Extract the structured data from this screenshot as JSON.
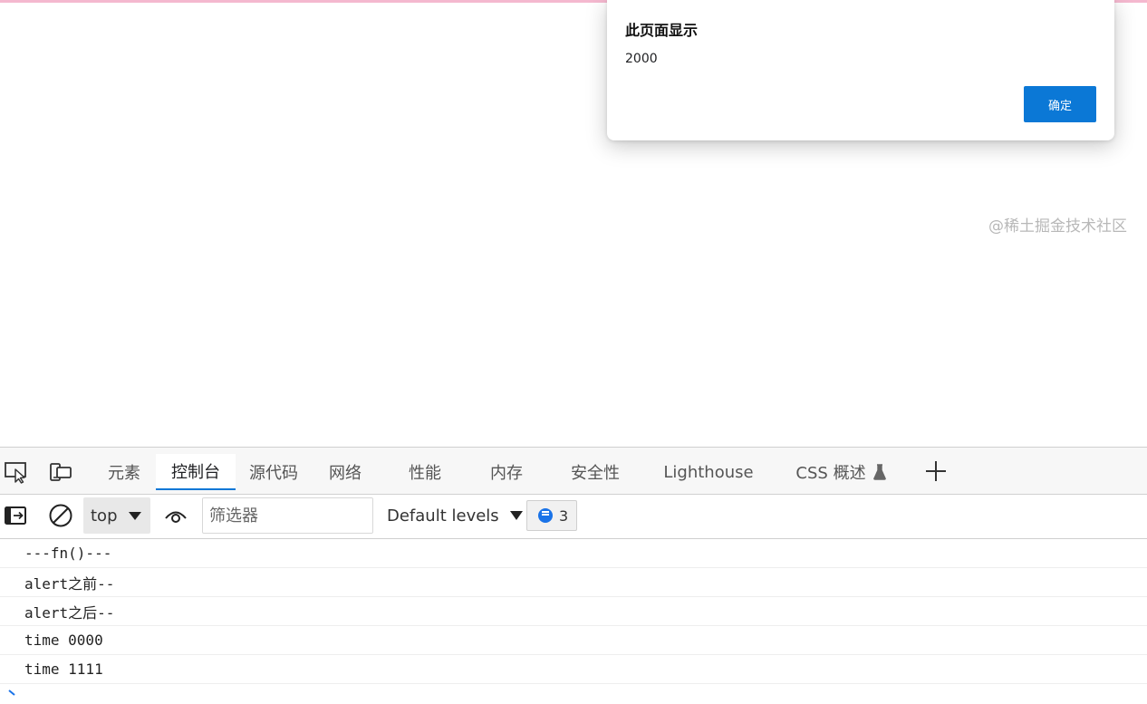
{
  "dialog": {
    "title": "此页面显示",
    "message": "2000",
    "ok_label": "确定"
  },
  "devtools": {
    "tabs": [
      {
        "label": "元素",
        "active": false
      },
      {
        "label": "控制台",
        "active": true
      },
      {
        "label": "源代码",
        "active": false
      },
      {
        "label": "网络",
        "active": false
      },
      {
        "label": "性能",
        "active": false
      },
      {
        "label": "内存",
        "active": false
      },
      {
        "label": "安全性",
        "active": false
      },
      {
        "label": "Lighthouse",
        "active": false
      },
      {
        "label": "CSS 概述",
        "active": false
      }
    ],
    "toolbar": {
      "context": "top",
      "filter_placeholder": "筛选器",
      "levels": "Default levels",
      "message_count": "3"
    },
    "console_lines": [
      "---fn()---",
      "alert之前--",
      "alert之后--",
      "time 0000",
      "time 1111"
    ]
  },
  "watermark": "@稀土掘金技术社区",
  "colors": {
    "accent": "#0b78d6",
    "top_strip": "#f4b8cf",
    "message_badge": "#1a73e8"
  }
}
